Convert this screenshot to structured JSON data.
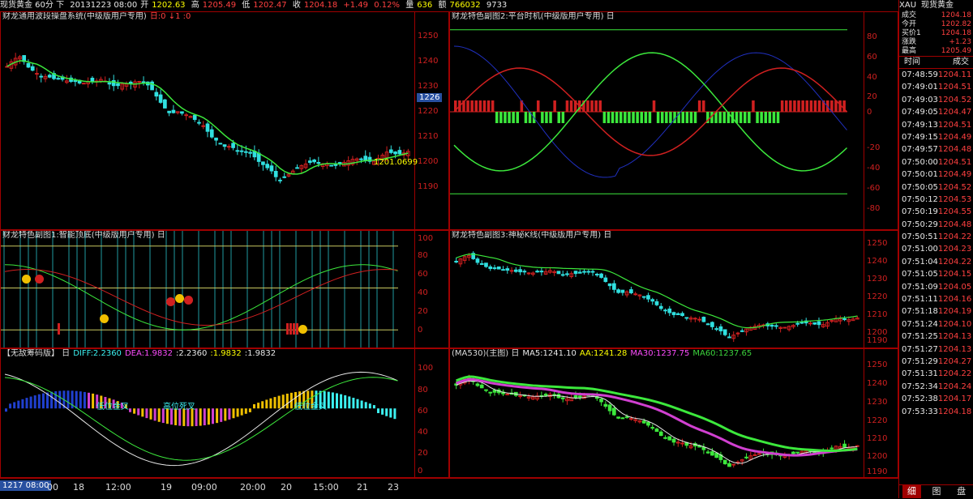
{
  "topbar": {
    "symbol": "现货黄金 60分 下",
    "datetime": "20131223 08:00",
    "open_label": "开",
    "open": "1202.63",
    "high_label": "高",
    "high": "1205.49",
    "low_label": "低",
    "low": "1202.47",
    "close_label": "收",
    "close": "1204.18",
    "change": "+1.49",
    "change_pct": "0.12%",
    "volume_label": "量",
    "volume": "636",
    "amount_label": "额",
    "amount": "766032",
    "extra": "9733"
  },
  "panel_main": {
    "title": "财龙通用波段操盘系统(中级版用户专用)",
    "flags": "日:0 ↓1 :0",
    "ticks": [
      "1250",
      "1240",
      "1230",
      "1220",
      "1210",
      "1200",
      "1190"
    ],
    "current_box": "1226",
    "annotation": "1201.0699"
  },
  "panel_fu2": {
    "title": "财龙特色副图2:平台时机(中级版用户专用) 日",
    "ticks": [
      "80",
      "60",
      "40",
      "20",
      "0",
      "-20",
      "-40",
      "-60",
      "-80"
    ]
  },
  "panel_fu1": {
    "title": "财龙特色副图1:智能顶底(中级版用户专用) 日",
    "ticks": [
      "100",
      "80",
      "60",
      "40",
      "20",
      "0"
    ]
  },
  "panel_fu3": {
    "title": "财龙特色副图3:神秘K线(中级版用户专用) 日",
    "ticks": [
      "1250",
      "1240",
      "1230",
      "1220",
      "1210",
      "1200",
      "1190"
    ]
  },
  "panel_macd": {
    "title": "【无敌筹码版】 日",
    "diff": "DIFF:2.2360",
    "dea": "DEA:1.9832",
    "v1": ":2.2360",
    "v2": ":1.9832",
    "v3": ":1.9832",
    "ticks": [
      "100",
      "80",
      "60",
      "40",
      "20",
      "0"
    ],
    "labels": [
      "低位金叉",
      "高位死叉",
      "低位金叉"
    ]
  },
  "panel_ma": {
    "title": "(MA530)(主图) 日",
    "ma5": "MA5:1241.10",
    "aa": "AA:1241.28",
    "ma30": "MA30:1237.75",
    "ma60": "MA60:1237.65",
    "ticks": [
      "1250",
      "1240",
      "1230",
      "1220",
      "1210",
      "1200",
      "1190"
    ]
  },
  "bottom_axis": {
    "current": "1217 08:00",
    "labels": [
      "00",
      "18",
      "12:00",
      "19",
      "09:00",
      "20:00",
      "20",
      "15:00",
      "21",
      "23"
    ]
  },
  "right": {
    "code": "XAU",
    "name": "现货黄金",
    "quote": [
      {
        "label": "成交",
        "value": "1204.18"
      },
      {
        "label": "今开",
        "value": "1202.82"
      },
      {
        "label": "买价1",
        "value": "1204.18"
      },
      {
        "label": "涨跌",
        "value": "+1.23"
      },
      {
        "label": "最高",
        "value": "1205.49"
      }
    ],
    "col_time": "时间",
    "col_deal": "成交",
    "trades": [
      {
        "t": "07:48:59",
        "p": "1204.11"
      },
      {
        "t": "07:49:01",
        "p": "1204.51"
      },
      {
        "t": "07:49:03",
        "p": "1204.52"
      },
      {
        "t": "07:49:05",
        "p": "1204.47"
      },
      {
        "t": "07:49:13",
        "p": "1204.51"
      },
      {
        "t": "07:49:15",
        "p": "1204.49"
      },
      {
        "t": "07:49:57",
        "p": "1204.48"
      },
      {
        "t": "07:50:00",
        "p": "1204.51"
      },
      {
        "t": "07:50:01",
        "p": "1204.49"
      },
      {
        "t": "07:50:05",
        "p": "1204.52"
      },
      {
        "t": "07:50:12",
        "p": "1204.53"
      },
      {
        "t": "07:50:19",
        "p": "1204.55"
      },
      {
        "t": "07:50:29",
        "p": "1204.48"
      },
      {
        "t": "07:50:51",
        "p": "1204.22"
      },
      {
        "t": "07:51:00",
        "p": "1204.23"
      },
      {
        "t": "07:51:04",
        "p": "1204.22"
      },
      {
        "t": "07:51:05",
        "p": "1204.15"
      },
      {
        "t": "07:51:09",
        "p": "1204.05"
      },
      {
        "t": "07:51:11",
        "p": "1204.16"
      },
      {
        "t": "07:51:18",
        "p": "1204.19"
      },
      {
        "t": "07:51:24",
        "p": "1204.10"
      },
      {
        "t": "07:51:25",
        "p": "1204.13"
      },
      {
        "t": "07:51:27",
        "p": "1204.13"
      },
      {
        "t": "07:51:29",
        "p": "1204.27"
      },
      {
        "t": "07:51:31",
        "p": "1204.22"
      },
      {
        "t": "07:52:34",
        "p": "1204.24"
      },
      {
        "t": "07:52:38",
        "p": "1204.17"
      },
      {
        "t": "07:53:33",
        "p": "1204.18"
      }
    ],
    "tabs": [
      "细",
      "图",
      "盘"
    ]
  }
}
